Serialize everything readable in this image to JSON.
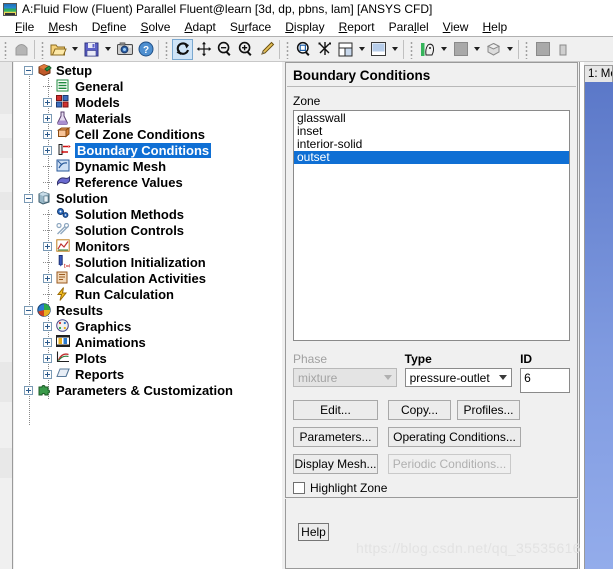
{
  "window": {
    "title": "A:Fluid Flow (Fluent) Parallel Fluent@learn  [3d, dp, pbns, lam] [ANSYS CFD]",
    "icon": "ansys-fluent-icon"
  },
  "menubar": {
    "items": [
      {
        "label": "File"
      },
      {
        "label": "Mesh"
      },
      {
        "label": "Define"
      },
      {
        "label": "Solve"
      },
      {
        "label": "Adapt"
      },
      {
        "label": "Surface"
      },
      {
        "label": "Display"
      },
      {
        "label": "Report"
      },
      {
        "label": "Parallel"
      },
      {
        "label": "View"
      },
      {
        "label": "Help"
      }
    ]
  },
  "toolbar": {
    "groups": [
      {
        "buttons": [
          {
            "icon": "stop-icon",
            "active": false,
            "caret": false
          }
        ]
      },
      {
        "buttons": [
          {
            "icon": "open-folder-icon",
            "active": false,
            "caret": true
          },
          {
            "icon": "save-disk-icon",
            "active": false,
            "caret": true
          },
          {
            "icon": "camera-icon",
            "active": false,
            "caret": false
          },
          {
            "icon": "help-question-icon",
            "active": false,
            "caret": false
          }
        ]
      },
      {
        "buttons": [
          {
            "icon": "rotate-refresh-icon",
            "active": true,
            "caret": false
          },
          {
            "icon": "pan-move-icon",
            "active": false,
            "caret": false
          },
          {
            "icon": "zoom-out-icon",
            "active": false,
            "caret": false
          },
          {
            "icon": "zoom-in-icon",
            "active": false,
            "caret": false
          },
          {
            "icon": "probe-eyedropper-icon",
            "active": false,
            "caret": false
          }
        ]
      },
      {
        "buttons": [
          {
            "icon": "zoom-fit-icon",
            "active": false,
            "caret": false
          },
          {
            "icon": "mesh-node-icon",
            "active": false,
            "caret": false
          },
          {
            "icon": "layout-grid-icon",
            "active": false,
            "caret": true
          },
          {
            "icon": "background-color-icon",
            "active": false,
            "caret": true
          }
        ]
      },
      {
        "buttons": [
          {
            "icon": "lighting-head-icon",
            "active": false,
            "caret": true
          },
          {
            "icon": "color-swatch-icon",
            "active": false,
            "caret": true
          },
          {
            "icon": "render-cube-icon",
            "active": false,
            "caret": true
          }
        ]
      },
      {
        "buttons": [
          {
            "icon": "color-swatch2-icon",
            "active": false,
            "caret": false
          },
          {
            "icon": "misc-icon",
            "active": false,
            "caret": false
          }
        ]
      }
    ]
  },
  "tree": {
    "nodes": [
      {
        "label": "Setup",
        "level": 0,
        "expander": "minus",
        "icon": "setup-icon",
        "bold": true,
        "selected": false
      },
      {
        "label": "General",
        "level": 1,
        "expander": "none",
        "icon": "general-icon",
        "bold": true,
        "selected": false
      },
      {
        "label": "Models",
        "level": 1,
        "expander": "plus",
        "icon": "models-icon",
        "bold": true,
        "selected": false
      },
      {
        "label": "Materials",
        "level": 1,
        "expander": "plus",
        "icon": "materials-icon",
        "bold": true,
        "selected": false
      },
      {
        "label": "Cell Zone Conditions",
        "level": 1,
        "expander": "plus",
        "icon": "cellzone-icon",
        "bold": true,
        "selected": false
      },
      {
        "label": "Boundary Conditions",
        "level": 1,
        "expander": "plus",
        "icon": "boundary-icon",
        "bold": true,
        "selected": true
      },
      {
        "label": "Dynamic Mesh",
        "level": 1,
        "expander": "none",
        "icon": "dynamicmesh-icon",
        "bold": true,
        "selected": false
      },
      {
        "label": "Reference Values",
        "level": 1,
        "expander": "none",
        "icon": "reference-icon",
        "bold": true,
        "selected": false
      },
      {
        "label": "Solution",
        "level": 0,
        "expander": "minus",
        "icon": "solution-icon",
        "bold": true,
        "selected": false
      },
      {
        "label": "Solution Methods",
        "level": 1,
        "expander": "none",
        "icon": "methods-icon",
        "bold": true,
        "selected": false
      },
      {
        "label": "Solution Controls",
        "level": 1,
        "expander": "none",
        "icon": "controls-icon",
        "bold": true,
        "selected": false
      },
      {
        "label": "Monitors",
        "level": 1,
        "expander": "plus",
        "icon": "monitors-icon",
        "bold": true,
        "selected": false
      },
      {
        "label": "Solution Initialization",
        "level": 1,
        "expander": "none",
        "icon": "initialization-icon",
        "bold": true,
        "selected": false
      },
      {
        "label": "Calculation Activities",
        "level": 1,
        "expander": "plus",
        "icon": "activities-icon",
        "bold": true,
        "selected": false
      },
      {
        "label": "Run Calculation",
        "level": 1,
        "expander": "none",
        "icon": "run-icon",
        "bold": true,
        "selected": false
      },
      {
        "label": "Results",
        "level": 0,
        "expander": "minus",
        "icon": "results-icon",
        "bold": true,
        "selected": false
      },
      {
        "label": "Graphics",
        "level": 1,
        "expander": "plus",
        "icon": "graphics-icon",
        "bold": true,
        "selected": false
      },
      {
        "label": "Animations",
        "level": 1,
        "expander": "plus",
        "icon": "animations-icon",
        "bold": true,
        "selected": false
      },
      {
        "label": "Plots",
        "level": 1,
        "expander": "plus",
        "icon": "plots-icon",
        "bold": true,
        "selected": false
      },
      {
        "label": "Reports",
        "level": 1,
        "expander": "plus",
        "icon": "reports-icon",
        "bold": true,
        "selected": false
      },
      {
        "label": "Parameters & Customization",
        "level": 0,
        "expander": "plus",
        "icon": "parameters-icon",
        "bold": true,
        "selected": false
      }
    ]
  },
  "task_panel": {
    "title": "Boundary Conditions",
    "zone": {
      "label": "Zone",
      "items": [
        {
          "name": "glasswall",
          "selected": false
        },
        {
          "name": "inset",
          "selected": false
        },
        {
          "name": "interior-solid",
          "selected": false
        },
        {
          "name": "outset",
          "selected": true
        }
      ]
    },
    "phase": {
      "label": "Phase",
      "value": "mixture",
      "disabled": true
    },
    "type": {
      "label": "Type",
      "value": "pressure-outlet",
      "disabled": false
    },
    "id": {
      "label": "ID",
      "value": "6"
    },
    "buttons": [
      {
        "label": "Edit...",
        "disabled": false,
        "name": "edit-button"
      },
      {
        "label": "Copy...",
        "disabled": false,
        "name": "copy-button"
      },
      {
        "label": "Profiles...",
        "disabled": false,
        "name": "profiles-button"
      },
      {
        "label": "Parameters...",
        "disabled": false,
        "name": "parameters-button"
      },
      {
        "label": "Operating Conditions...",
        "disabled": false,
        "name": "operating-conditions-button"
      },
      {
        "label": "Display Mesh...",
        "disabled": false,
        "name": "display-mesh-button"
      },
      {
        "label": "Periodic Conditions...",
        "disabled": true,
        "name": "periodic-conditions-button"
      }
    ],
    "highlight_zone": {
      "label": "Highlight Zone",
      "checked": false
    }
  },
  "help": {
    "label": "Help"
  },
  "graphics": {
    "tab_label": "1: Me",
    "background_color": "#7f9ae0"
  },
  "watermark": {
    "text": "https://blog.csdn.net/qq_35535616"
  },
  "colors": {
    "selection_blue": "#0f6fd4",
    "panel_gray": "#f0f0f0",
    "toolbar_active": "#cfe4f7"
  }
}
